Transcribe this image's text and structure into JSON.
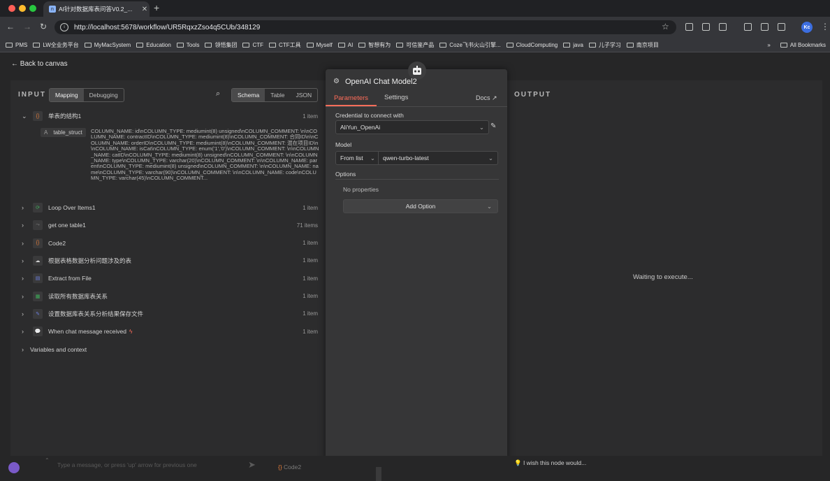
{
  "browser": {
    "tab_title": "AI针对数据库表问答V0.2_...",
    "new_tab": "+",
    "url": "http://localhost:5678/workflow/UR5RqxzZso4q5CUb/348129",
    "bookmarks": [
      "PMS",
      "LW全业务平台",
      "MyMacSystem",
      "Education",
      "Tools",
      "领悟集团",
      "CTF",
      "CTF工具",
      "Myself",
      "AI",
      "智想有为",
      "可信鉴产品",
      "Coze飞书火山引擎...",
      "CloudComputing",
      "java",
      "儿子学习",
      "南京项目"
    ],
    "more": "»",
    "all_bookmarks": "All Bookmarks",
    "avatar_text": "Kc"
  },
  "back": "Back to canvas",
  "input": {
    "title": "INPUT",
    "mode_tabs": [
      "Mapping",
      "Debugging"
    ],
    "view_tabs": [
      "Schema",
      "Table",
      "JSON"
    ],
    "root_node": {
      "name": "单表的结构1",
      "count": "1 item"
    },
    "field_name": "table_struct",
    "field_type": "A",
    "field_value": "COLUMN_NAME: id\\nCOLUMN_TYPE: mediumint(8) unsigned\\nCOLUMN_COMMENT: \\n\\nCOLUMN_NAME: contractID\\nCOLUMN_TYPE: mediumint(8)\\nCOLUMN_COMMENT: 合同ID\\n\\nCOLUMN_NAME: orderID\\nCOLUMN_TYPE: mediumint(8)\\nCOLUMN_COMMENT: 混在项目ID\\n\\nCOLUMN_NAME: isCat\\nCOLUMN_TYPE: enum('1','0')\\nCOLUMN_COMMENT: \\n\\nCOLUMN_NAME: catID\\nCOLUMN_TYPE: mediumint(8) unsigned\\nCOLUMN_COMMENT: \\n\\nCOLUMN_NAME: type\\nCOLUMN_TYPE: varchar(20)\\nCOLUMN_COMMENT: \\n\\nCOLUMN_NAME: parent\\nCOLUMN_TYPE: mediumint(8) unsigned\\nCOLUMN_COMMENT: \\n\\nCOLUMN_NAME: name\\nCOLUMN_TYPE: varchar(90)\\nCOLUMN_COMMENT: \\n\\nCOLUMN_NAME: code\\nCOLUMN_TYPE: varchar(45)\\nCOLUMN_COMMENT...",
    "nodes": [
      {
        "name": "Loop Over Items1",
        "count": "1 item",
        "icon": "⟳",
        "color": "#3fae5a"
      },
      {
        "name": "get one table1",
        "count": "71 items",
        "icon": "⤳",
        "color": "#7a7a7a"
      },
      {
        "name": "Code2",
        "count": "1 item",
        "icon": "{}",
        "color": "#e07b3a"
      },
      {
        "name": "根据表格数据分析问题涉及的表",
        "count": "1 item",
        "icon": "☁",
        "color": "#cfcfcf"
      },
      {
        "name": "Extract from File",
        "count": "1 item",
        "icon": "▤",
        "color": "#6d7fe0"
      },
      {
        "name": "读取所有数据库表关系",
        "count": "1 item",
        "icon": "▦",
        "color": "#3fae5a"
      },
      {
        "name": "设置数据库表关系分析结果保存文件",
        "count": "1 item",
        "icon": "✎",
        "color": "#6d7fe0"
      },
      {
        "name": "When chat message received",
        "count": "1 item",
        "icon": "💬",
        "color": "#cfcfcf"
      }
    ],
    "variables": "Variables and context"
  },
  "node_panel": {
    "title": "OpenAI Chat Model2",
    "tabs": [
      "Parameters",
      "Settings"
    ],
    "docs": "Docs",
    "credential_label": "Credential to connect with",
    "credential_value": "AliYun_OpenAi",
    "model_label": "Model",
    "model_mode": "From list",
    "model_value": "qwen-turbo-latest",
    "options_label": "Options",
    "no_properties": "No properties",
    "add_option": "Add Option",
    "wish": "I wish this node would..."
  },
  "output": {
    "title": "OUTPUT",
    "waiting": "Waiting to execute..."
  },
  "bottom": {
    "chat_placeholder": "Type a message, or press 'up' arrow for previous one",
    "code_node": "Code2"
  },
  "colors": {
    "accent": "#ff6d5a",
    "bg": "#262627",
    "panel": "#2c2c2d"
  }
}
